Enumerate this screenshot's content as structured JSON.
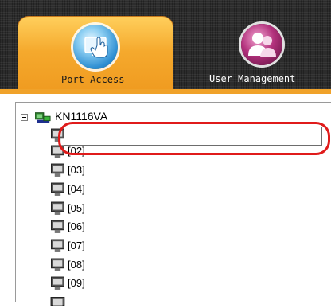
{
  "tabs": [
    {
      "label": "Port Access",
      "icon": "monitor-hand-icon",
      "active": true
    },
    {
      "label": "User Management",
      "icon": "users-icon",
      "active": false
    }
  ],
  "tree": {
    "root": {
      "label": "KN1116VA",
      "icon": "network-computer-icon",
      "expanded": true
    },
    "rename_input": {
      "value": "",
      "placeholder": ""
    },
    "ports": [
      "[02]",
      "[03]",
      "[04]",
      "[05]",
      "[06]",
      "[07]",
      "[08]",
      "[09]"
    ]
  },
  "colors": {
    "accent": "#f5a92d",
    "highlight": "#e01b1b",
    "toolbar": "#2c2c2c"
  }
}
